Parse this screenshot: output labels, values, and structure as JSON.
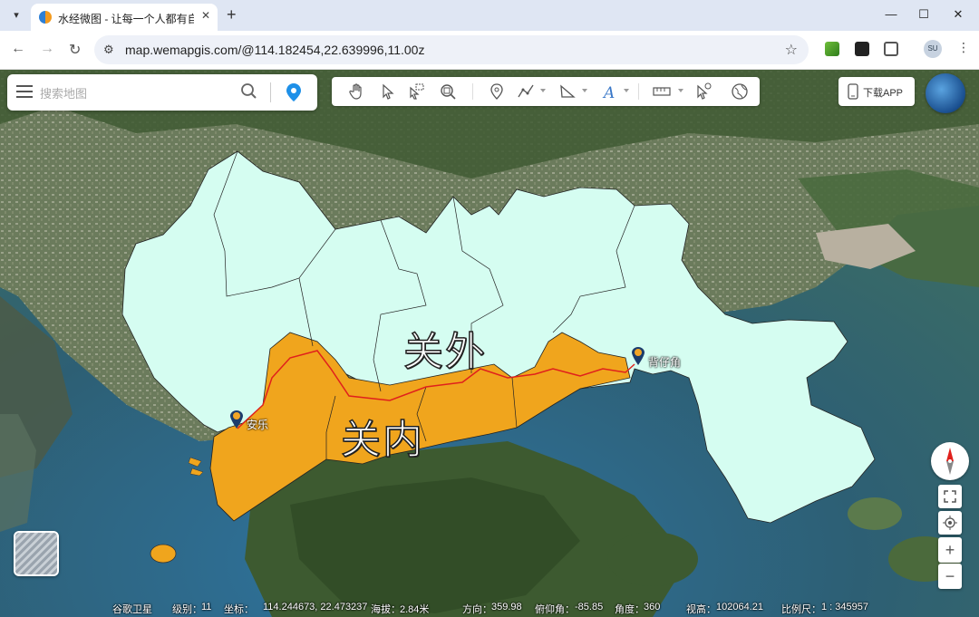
{
  "browser": {
    "tab_title": "水经微图 - 让每一个人都有自己",
    "url": "map.wemapgis.com/@114.182454,22.639996,11.00z",
    "profile_initials": "SU"
  },
  "search": {
    "placeholder": "搜索地图"
  },
  "toolbar": {
    "tools": [
      "pan-tool",
      "select-tool",
      "box-select-tool",
      "search-zoom-tool",
      "marker-tool",
      "line-tool",
      "polygon-tool",
      "text-tool",
      "ruler-tool",
      "identify-tool",
      "globe-tool"
    ]
  },
  "download": {
    "label": "下载APP"
  },
  "map": {
    "outer_region_label": "关外",
    "inner_region_label": "关内",
    "places": [
      {
        "name": "安乐"
      },
      {
        "name": "背仔角"
      }
    ],
    "colors": {
      "outer": "#d5fdf1",
      "inner": "#f0a51d",
      "boundary": "#e0201c",
      "water": "#3b6e78"
    }
  },
  "status": {
    "source": "谷歌卫星",
    "level_label": "级别：",
    "level_value": "11",
    "coord_label": "坐标：",
    "coord_value": "114.244673, 22.473237",
    "alt_label": "海拔：",
    "alt_value": "2.84米",
    "heading_label": "方向：",
    "heading_value": "359.98",
    "pitch_label": "俯仰角：",
    "pitch_value": "-85.85",
    "angle_label": "角度：",
    "angle_value": "360",
    "view_height_label": "视高：",
    "view_height_value": "102064.21",
    "scale_label": "比例尺：",
    "scale_value": "1 : 345957"
  }
}
